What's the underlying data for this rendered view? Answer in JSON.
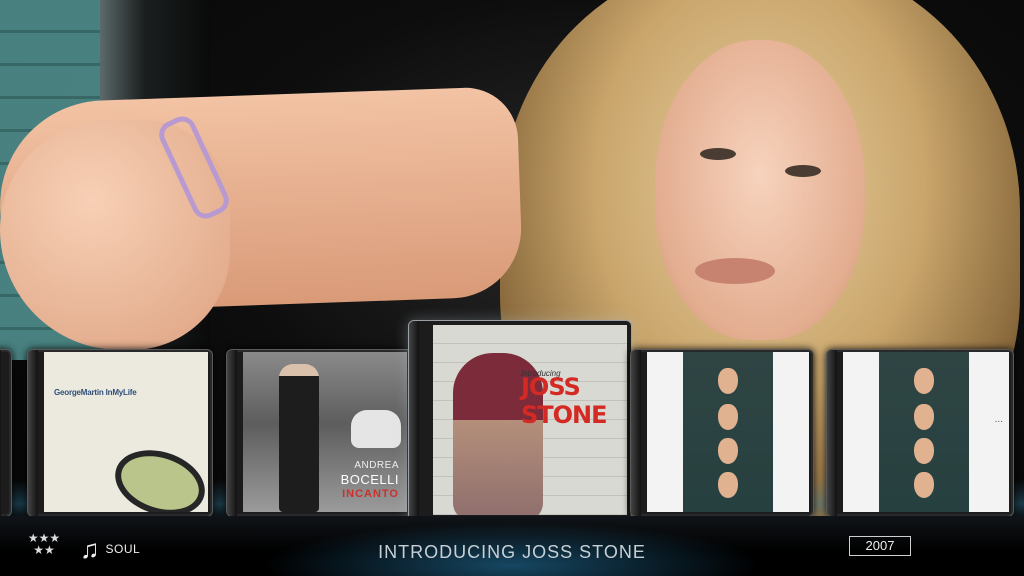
{
  "albums": [
    {
      "id": "left-edge",
      "art_text": ""
    },
    {
      "id": "george-martin",
      "art_text": "GeorgeMartin InMyLife"
    },
    {
      "id": "andrea-bocelli",
      "art_line1": "ANDREA",
      "art_line2": "BOCELLI",
      "art_line3": "INCANTO"
    },
    {
      "id": "joss-stone",
      "art_intro": "Introducing",
      "art_name": "JOSS STONE"
    },
    {
      "id": "masks-1",
      "art_text": ""
    },
    {
      "id": "masks-2",
      "art_text": "..."
    }
  ],
  "footer": {
    "rating": "★★★\n★★",
    "genre": "SOUL",
    "title": "INTRODUCING JOSS STONE",
    "year": "2007"
  },
  "icons": {
    "note": "music-note-icon",
    "stars": "rating-stars-icon"
  },
  "colors": {
    "accent": "#3c96be",
    "text": "#c8d0d6"
  }
}
